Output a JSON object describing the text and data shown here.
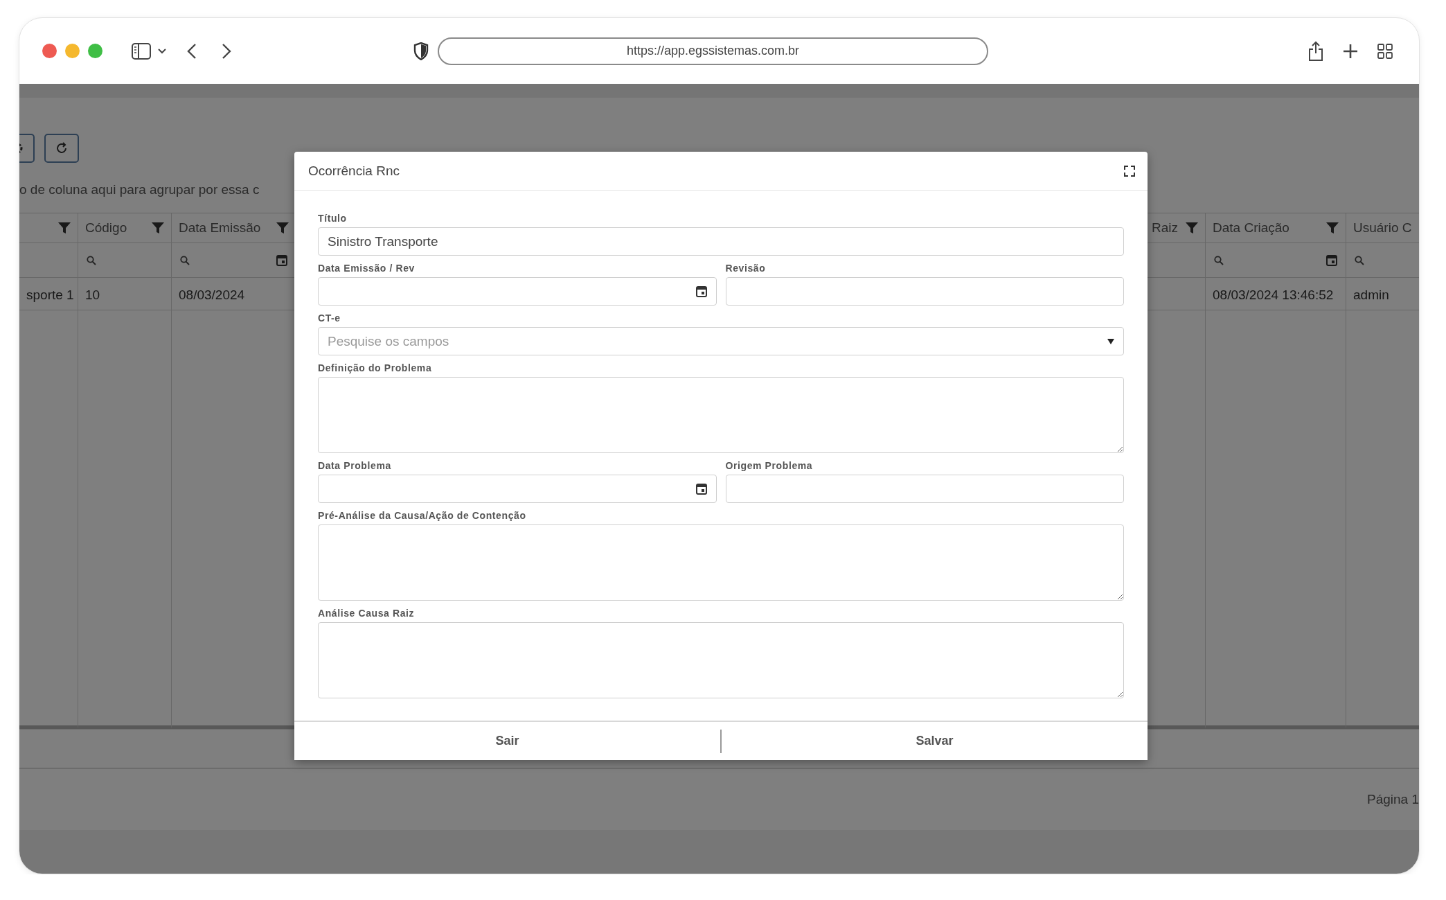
{
  "browser": {
    "url": "https://app.egssistemas.com.br"
  },
  "background_page": {
    "toolbar_buttons": [
      {
        "kind": "gear"
      },
      {
        "kind": "refresh"
      }
    ],
    "group_hint": "o de coluna aqui para agrupar por essa c",
    "table": {
      "left_columns": [
        {
          "filter_icon": true,
          "search_icon": false,
          "calendar_icon": false
        },
        {
          "label": "Código",
          "filter_icon": true,
          "search_icon": true,
          "calendar_icon": false
        },
        {
          "label": "Data Emissão",
          "filter_icon": true,
          "search_icon": true,
          "calendar_icon": true
        }
      ],
      "right_columns": [
        {
          "label": "Raiz",
          "filter_icon": true,
          "search_icon": false,
          "calendar_icon": false
        },
        {
          "label": "Data Criação",
          "filter_icon": true,
          "search_icon": true,
          "calendar_icon": true
        },
        {
          "label": "Usuário C",
          "filter_icon": false,
          "search_icon": true,
          "calendar_icon": false
        }
      ],
      "rows": [
        {
          "left_cells": [
            "sporte 1",
            "10",
            "08/03/2024"
          ],
          "right_cells": [
            null,
            "08/03/2024 13:46:52",
            "admin"
          ]
        }
      ]
    },
    "pager": "Página 1"
  },
  "dialog": {
    "title": "Ocorrência Rnc",
    "rows": [
      [
        {
          "kind": "text",
          "label": "Título",
          "value": "Sinistro Transporte"
        }
      ],
      [
        {
          "kind": "date",
          "label": "Data Emissão / Rev"
        },
        {
          "kind": "text",
          "label": "Revisão"
        }
      ],
      [
        {
          "kind": "select",
          "label": "CT-e",
          "placeholder": "Pesquise os campos"
        }
      ],
      [
        {
          "kind": "textarea",
          "label": "Definição do Problema"
        }
      ],
      [
        {
          "kind": "date",
          "label": "Data Problema"
        },
        {
          "kind": "text",
          "label": "Origem Problema"
        }
      ],
      [
        {
          "kind": "textarea",
          "label": "Pré-Análise da Causa/Ação de Contenção"
        }
      ],
      [
        {
          "kind": "textarea",
          "label": "Análise Causa Raiz"
        }
      ]
    ],
    "buttons": [
      "Sair",
      "Salvar"
    ]
  }
}
